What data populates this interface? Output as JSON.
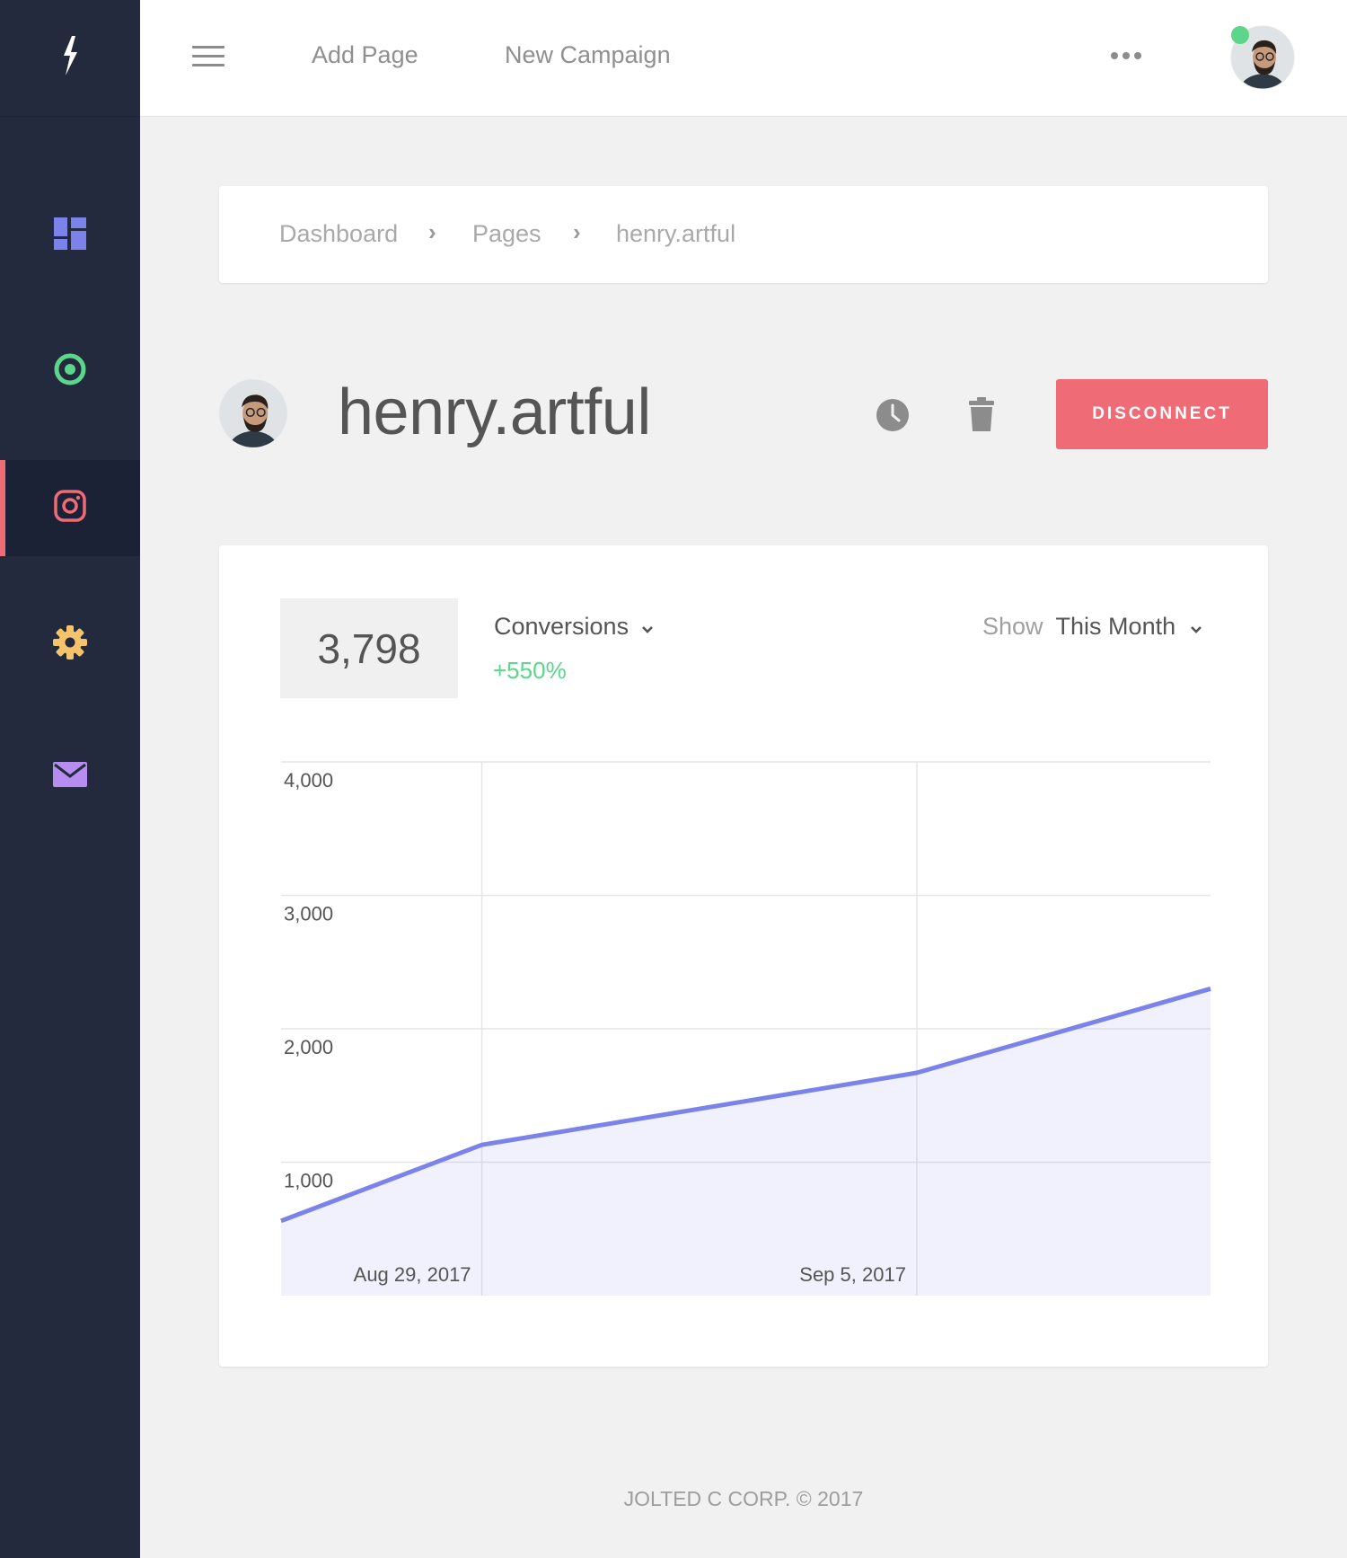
{
  "header": {
    "add_page": "Add Page",
    "new_campaign": "New Campaign"
  },
  "sidebar": {
    "items": [
      {
        "icon": "dashboard-icon",
        "color": "#7b83eb"
      },
      {
        "icon": "target-icon",
        "color": "#5cd68a"
      },
      {
        "icon": "instagram-icon",
        "color": "#ef6b75",
        "active": true
      },
      {
        "icon": "gear-icon",
        "color": "#f5c36b"
      },
      {
        "icon": "mail-icon",
        "color": "#b78ef0"
      }
    ]
  },
  "breadcrumb": {
    "items": [
      "Dashboard",
      "Pages",
      "henry.artful"
    ],
    "separator": "›"
  },
  "page": {
    "title": "henry.artful",
    "disconnect_label": "DISCONNECT"
  },
  "metric": {
    "value": "3,798",
    "name": "Conversions",
    "change": "+550%",
    "show_label": "Show",
    "period": "This Month"
  },
  "colors": {
    "accent": "#7b83eb",
    "danger": "#ef6b75",
    "positive": "#5cd68a",
    "sidebar_bg": "#232a3d"
  },
  "chart_data": {
    "type": "area",
    "x": [
      "Aug 26, 2017",
      "Aug 29, 2017",
      "Sep 5, 2017",
      "Sep 9, 2017"
    ],
    "values": [
      560,
      1130,
      1670,
      2300
    ],
    "xticks": [
      "Aug 29, 2017",
      "Sep 5, 2017"
    ],
    "yticks": [
      "1,000",
      "2,000",
      "3,000",
      "4,000"
    ],
    "ylim": [
      0,
      4000
    ],
    "grid": true,
    "legend": false
  },
  "footer": {
    "text": "JOLTED C CORP. © 2017"
  }
}
